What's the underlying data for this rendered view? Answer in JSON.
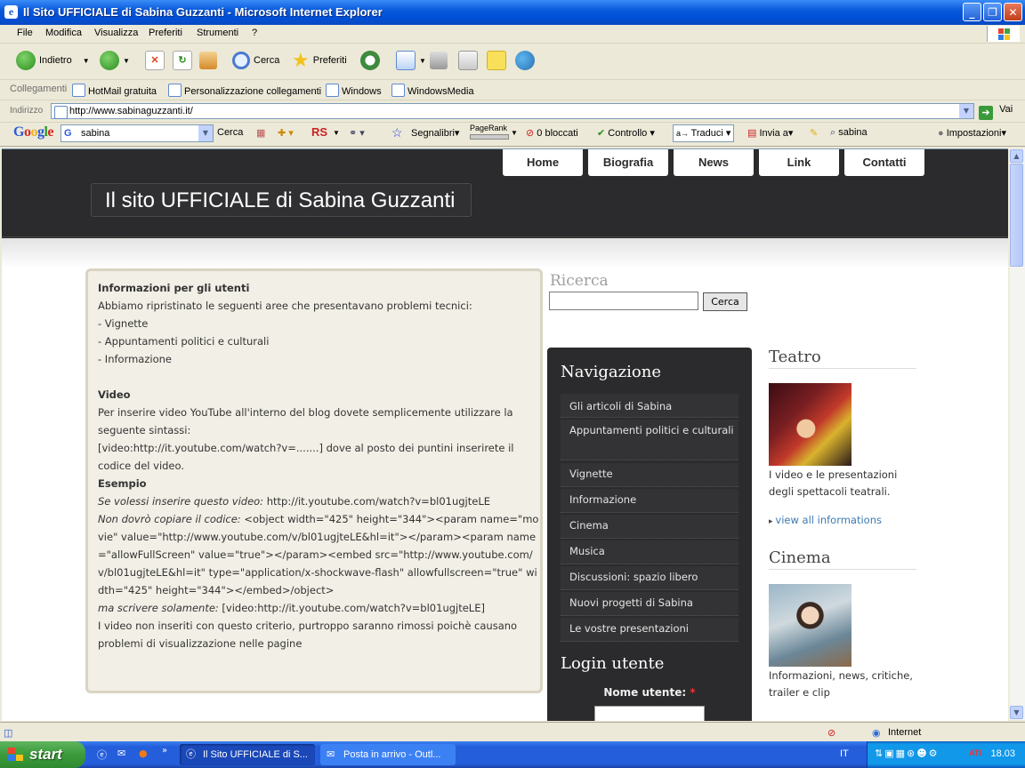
{
  "window": {
    "title": "Il Sito UFFICIALE di Sabina Guzzanti - Microsoft Internet Explorer"
  },
  "menu": [
    "File",
    "Modifica",
    "Visualizza",
    "Preferiti",
    "Strumenti",
    "?"
  ],
  "toolbar": {
    "back": "Indietro",
    "search": "Cerca",
    "favorites": "Preferiti"
  },
  "links": {
    "label": "Collegamenti",
    "items": [
      "HotMail gratuita",
      "Personalizzazione collegamenti",
      "Windows",
      "WindowsMedia"
    ]
  },
  "address": {
    "label": "Indirizzo",
    "url": "http://www.sabinaguzzanti.it/",
    "go": "Vai"
  },
  "google": {
    "logo": "Google",
    "query": "sabina",
    "search": "Cerca",
    "rs": "RS",
    "bookmarks": "Segnalibri",
    "pagerank": "PageRank",
    "blocked": "0 bloccati",
    "check": "Controllo",
    "translate": "Traduci",
    "send": "Invia a",
    "highlight": "sabina",
    "settings": "Impostazioni"
  },
  "site": {
    "nav": [
      "Home",
      "Biografia",
      "News",
      "Link",
      "Contatti"
    ],
    "title": "Il sito UFFICIALE di Sabina Guzzanti",
    "info": {
      "heading": "Informazioni per gli utenti",
      "intro": "Abbiamo ripristinato le seguenti aree che presentavano problemi tecnici:",
      "areas": [
        "- Vignette",
        "- Appuntamenti politici e culturali",
        "- Informazione"
      ],
      "video_heading": "Video",
      "video_p1": "Per inserire video YouTube all'interno del blog dovete semplicemente utilizzare la seguente sintassi:",
      "video_p2": "[video:http://it.youtube.com/watch?v=.......] dove al posto dei puntini inserirete il codice del video.",
      "example_heading": "Esempio",
      "ex1_label": "Se volessi inserire questo video:",
      "ex1_value": " http://it.youtube.com/watch?v=bl01ugjteLE",
      "ex2_label": "Non dovrò copiare il codice:",
      "ex2_value": " <object width=\"425\" height=\"344\"><param name=\"movie\" value=\"http://www.youtube.com/v/bl01ugjteLE&hl=it\"></param><param name=\"allowFullScreen\" value=\"true\"></param><embed src=\"http://www.youtube.com/v/bl01ugjteLE&hl=it\" type=\"application/x-shockwave-flash\" allowfullscreen=\"true\" width=\"425\" height=\"344\"></embed>/object>",
      "ex3_label": "ma scrivere solamente:",
      "ex3_value": " [video:http://it.youtube.com/watch?v=bl01ugjteLE]",
      "footer": "I video non inseriti con questo criterio, purtroppo saranno rimossi poichè causano problemi di visualizzazione nelle pagine"
    },
    "search": {
      "title": "Ricerca",
      "button": "Cerca"
    },
    "navigation": {
      "title": "Navigazione",
      "items": [
        "Gli articoli di Sabina",
        "Appuntamenti politici e culturali",
        "Vignette",
        "Informazione",
        "Cinema",
        "Musica",
        "Discussioni: spazio libero",
        "Nuovi progetti di Sabina",
        "Le vostre presentazioni"
      ]
    },
    "login": {
      "title": "Login utente",
      "username_label": "Nome utente:",
      "required": "*"
    },
    "teatro": {
      "title": "Teatro",
      "text": "I video e le presentazioni degli spettacoli teatrali.",
      "link": "view all informations"
    },
    "cinema": {
      "title": "Cinema",
      "text": "Informazioni, news, critiche, trailer e clip"
    }
  },
  "status": {
    "zone": "Internet"
  },
  "taskbar": {
    "start": "start",
    "tasks": [
      "Il Sito UFFICIALE di S...",
      "Posta in arrivo - Outl..."
    ],
    "lang": "IT",
    "time": "18.03"
  },
  "colors": {
    "header": "#2b2b2d",
    "link": "#3d7ab0",
    "xp_blue": "#0a5adc",
    "start_green": "#3c9a3c"
  }
}
